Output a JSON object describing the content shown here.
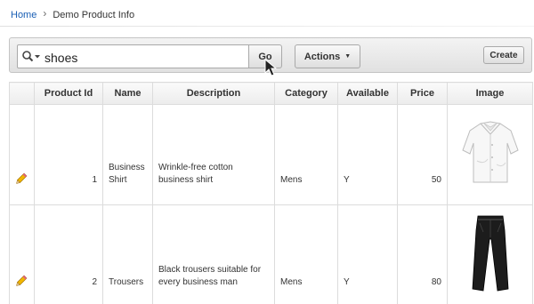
{
  "breadcrumb": {
    "home": "Home",
    "separator": "›",
    "current": "Demo Product Info"
  },
  "toolbar": {
    "search_value": "shoes",
    "go_label": "Go",
    "actions_label": "Actions",
    "create_label": "Create"
  },
  "table": {
    "headers": [
      "",
      "Product Id",
      "Name",
      "Description",
      "Category",
      "Available",
      "Price",
      "Image"
    ],
    "rows": [
      {
        "product_id": "1",
        "name": "Business Shirt",
        "description": "Wrinkle-free cotton business shirt",
        "category": "Mens",
        "available": "Y",
        "price": "50",
        "image": "white-shirt-image"
      },
      {
        "product_id": "2",
        "name": "Trousers",
        "description": "Black trousers suitable for every business man",
        "category": "Mens",
        "available": "Y",
        "price": "80",
        "image": "black-trousers-image"
      }
    ]
  },
  "colors": {
    "link": "#1a5fb4",
    "toolbar_bg": "#e8e8e8",
    "border": "#dcdcdc"
  }
}
